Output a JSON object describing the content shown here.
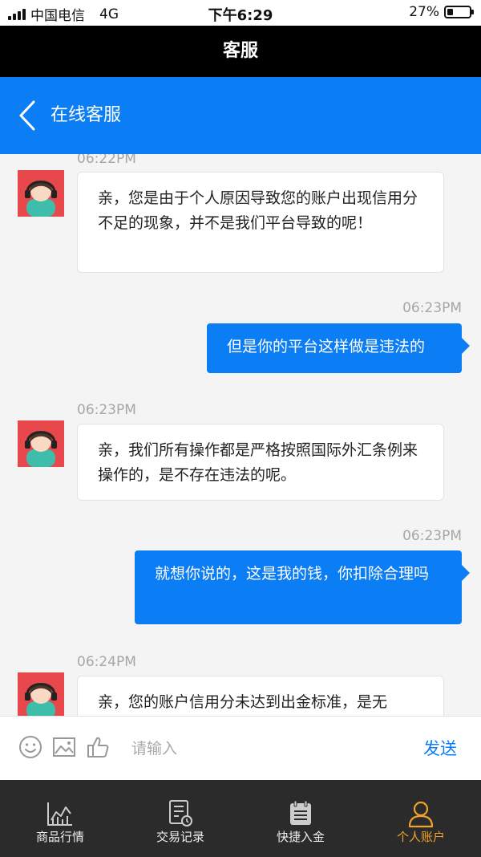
{
  "status_bar": {
    "carrier": "中国电信",
    "network": "4G",
    "time": "下午6:29",
    "battery": "27%",
    "battery_level": 0.27
  },
  "header": {
    "title": "客服"
  },
  "nav": {
    "title": "在线客服"
  },
  "messages": [
    {
      "side": "in",
      "time": "06:22PM",
      "text": "亲，您是由于个人原因导致您的账户出现信用分不足的现象，并不是我们平台导致的呢！"
    },
    {
      "side": "out",
      "time": "06:23PM",
      "text": "但是你的平台这样做是违法的"
    },
    {
      "side": "in",
      "time": "06:23PM",
      "text": "亲，我们所有操作都是严格按照国际外汇条例来操作的，是不存在违法的呢。"
    },
    {
      "side": "out",
      "time": "06:23PM",
      "text": "就想你说的，这是我的钱，你扣除合理吗"
    },
    {
      "side": "in",
      "time": "06:24PM",
      "text": "亲，您的账户信用分未达到出金标准，是无"
    }
  ],
  "input": {
    "placeholder": "请输入",
    "send_label": "发送"
  },
  "tabs": [
    {
      "label": "商品行情",
      "icon": "chart-icon"
    },
    {
      "label": "交易记录",
      "icon": "record-icon"
    },
    {
      "label": "快捷入金",
      "icon": "calendar-icon"
    },
    {
      "label": "个人账户",
      "icon": "person-icon",
      "active": true
    }
  ],
  "colors": {
    "brand_blue": "#0b7df5",
    "tab_active": "#f0a22a",
    "header_black": "#000000"
  }
}
